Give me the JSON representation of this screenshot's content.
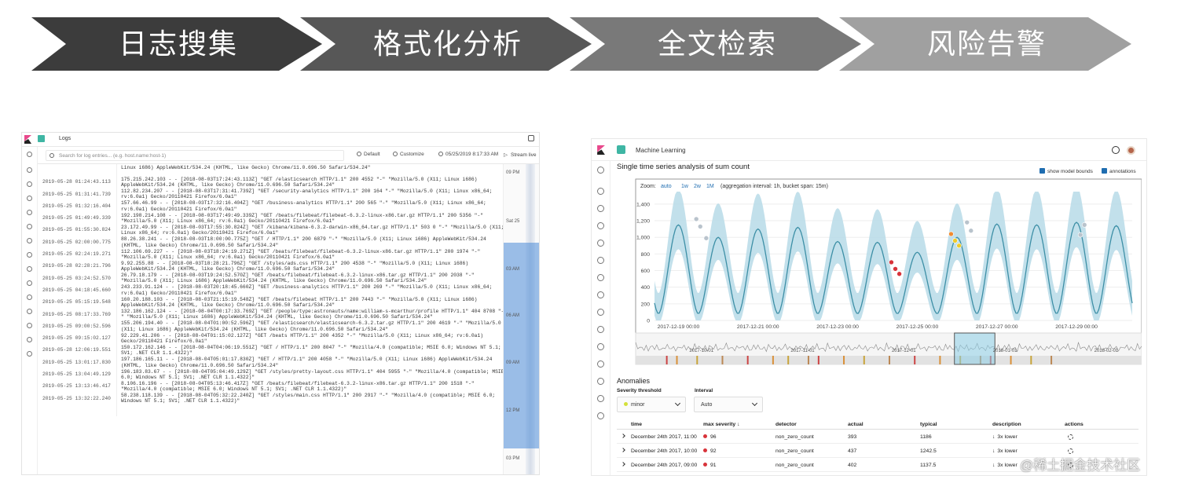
{
  "banner": {
    "steps": [
      "日志搜集",
      "格式化分析",
      "全文检索",
      "风险告警"
    ],
    "colors": [
      "#3c3c3c",
      "#575757",
      "#797979",
      "#a0a0a0"
    ]
  },
  "logs_app": {
    "title": "Logs",
    "search_placeholder": "Search for log entries... (e.g. host.name:host-1)",
    "default_label": "Default",
    "customize_label": "Customize",
    "date_label": "05/25/2019 8:17:33 AM",
    "stream_label": "Stream live",
    "minimap_labels": [
      "09 PM",
      "Sat 25",
      "03 AM",
      "06 AM",
      "09 AM",
      "12 PM",
      "03 PM"
    ],
    "rows": [
      {
        "ts": "",
        "msg": "Linux i686) AppleWebKit/534.24 (KHTML, like Gecko) Chrome/11.0.696.50 Safari/534.24\""
      },
      {
        "ts": "2019-05-28 01:24:43.113",
        "msg": "175.215.242.103 - - [2018-08-03T17:24:43.113Z] \"GET /elasticsearch HTTP/1.1\" 200 4552 \"-\" \"Mozilla/5.0 (X11; Linux i686) AppleWebKit/534.24 (KHTML, like Gecko) Chrome/11.0.696.50 Safari/534.24\""
      },
      {
        "ts": "2019-05-25 01:31:41.739",
        "msg": "112.82.234.207 - - [2018-08-03T17:31:41.739Z] \"GET /security-analytics HTTP/1.1\" 200 164 \"-\" \"Mozilla/5.0 (X11; Linux x86_64; rv:6.0a1) Gecko/20110421 Firefox/6.0a1\""
      },
      {
        "ts": "2019-05-25 01:32:16.404",
        "msg": "157.66.46.99 - - [2018-08-03T17:32:16.404Z] \"GET /business-analytics HTTP/1.1\" 200 565 \"-\" \"Mozilla/5.0 (X11; Linux x86_64; rv:6.0a1) Gecko/20110421 Firefox/6.0a1\""
      },
      {
        "ts": "2019-05-25 01:49:49.339",
        "msg": "192.198.214.108 - - [2018-08-03T17:49:49.339Z] \"GET /beats/filebeat/filebeat-6.3.2-linux-x86.tar.gz HTTP/1.1\" 200 5356 \"-\" \"Mozilla/5.0 (X11; Linux x86_64; rv:6.0a1) Gecko/20110421 Firefox/6.0a1\""
      },
      {
        "ts": "2019-05-25 01:55:30.824",
        "msg": "23.172.49.99 - - [2018-08-03T17:55:30.824Z] \"GET /kibana/kibana-6.3.2-darwin-x86_64.tar.gz HTTP/1.1\" 503 0 \"-\" \"Mozilla/5.0 (X11; Linux x86_64; rv:6.0a1) Gecko/20110421 Firefox/6.0a1\""
      },
      {
        "ts": "2019-05-25 02:00:00.775",
        "msg": "88.26.38.241 - - [2018-08-03T18:00:00.775Z] \"GET / HTTP/1.1\" 200 6879 \"-\" \"Mozilla/5.0 (X11; Linux i686) AppleWebKit/534.24 (KHTML, like Gecko) Chrome/11.0.696.50 Safari/534.24\""
      },
      {
        "ts": "2019-05-25 02:24:19.271",
        "msg": "112.106.69.227 - - [2018-08-03T18:24:19.271Z] \"GET /beats/filebeat/filebeat-6.3.2-linux-x86.tar.gz HTTP/1.1\" 200 1974 \"-\" \"Mozilla/5.0 (X11; Linux x86_64; rv:6.0a1) Gecko/20110421 Firefox/6.0a1\""
      },
      {
        "ts": "2019-05-28 02:28:21.796",
        "msg": "9.92.255.88 - - [2018-08-03T18:28:21.796Z] \"GET /styles/ads.css HTTP/1.1\" 200 4538 \"-\" \"Mozilla/5.0 (X11; Linux i686) AppleWebKit/534.24 (KHTML, like Gecko) Chrome/11.0.696.50 Safari/534.24\""
      },
      {
        "ts": "2019-05-25 03:24:52.570",
        "msg": "26.79.18.179 - - [2018-08-03T19:24:52.570Z] \"GET /beats/filebeat/filebeat-6.3.2-linux-x86.tar.gz HTTP/1.1\" 200 2038 \"-\" \"Mozilla/5.0 (X11; Linux i686) AppleWebKit/534.24 (KHTML, like Gecko) Chrome/11.0.696.50 Safari/534.24\""
      },
      {
        "ts": "2019-05-25 04:18:45.660",
        "msg": "243.233.91.124 - - [2018-08-03T20:18:45.660Z] \"GET /business-analytics HTTP/1.1\" 200 269 \"-\" \"Mozilla/5.0 (X11; Linux x86_64; rv:6.0a1) Gecko/20110421 Firefox/6.0a1\""
      },
      {
        "ts": "2019-05-25 05:15:19.548",
        "msg": "160.20.188.103 - - [2018-08-03T21:15:19.548Z] \"GET /beats/filebeat HTTP/1.1\" 200 7443 \"-\" \"Mozilla/5.0 (X11; Linux i686) AppleWebKit/534.24 (KHTML, like Gecko) Chrome/11.0.696.50 Safari/534.24\""
      },
      {
        "ts": "2019-05-25 08:17:33.769",
        "msg": "132.186.162.124 - - [2018-08-04T00:17:33.769Z] \"GET /people/type:astronauts/name:william-s-mcarthur/profile HTTP/1.1\" 404 8708 \"-\" \"Mozilla/5.0 (X11; Linux i686) AppleWebKit/534.24 (KHTML, like Gecko) Chrome/11.0.696.50 Safari/534.24\""
      },
      {
        "ts": "2019-05-25 09:00:52.596",
        "msg": "155.206.194.40 - - [2018-08-04T01:00:52.596Z] \"GET /elasticsearch/elasticsearch-6.3.2.tar.gz HTTP/1.1\" 200 4619 \"-\" \"Mozilla/5.0 (X11; Linux i686) AppleWebKit/534.24 (KHTML, like Gecko) Chrome/11.0.696.50 Safari/534.24\""
      },
      {
        "ts": "2019-05-25 09:15:02.127",
        "msg": "92.229.41.206 - - [2018-08-04T01:15:02.127Z] \"GET /beats HTTP/1.1\" 200 4352 \"-\" \"Mozilla/5.0 (X11; Linux x86_64; rv:6.0a1) Gecko/20110421 Firefox/6.0a1\""
      },
      {
        "ts": "2019-05-28 12:06:19.551",
        "msg": "150.172.162.146 - - [2018-08-04T04:06:19.551Z] \"GET / HTTP/1.1\" 200 8047 \"-\" \"Mozilla/4.0 (compatible; MSIE 6.0; Windows NT 5.1; SV1; .NET CLR 1.1.4322)\""
      },
      {
        "ts": "2019-05-25 13:01:17.830",
        "msg": "197.186.165.11 - - [2018-08-04T05:01:17.830Z] \"GET / HTTP/1.1\" 200 4058 \"-\" \"Mozilla/5.0 (X11; Linux i686) AppleWebKit/534.24 (KHTML, like Gecko) Chrome/11.0.696.50 Safari/534.24\""
      },
      {
        "ts": "2019-05-25 13:04:49.129",
        "msg": "196.183.83.67 - - [2018-08-04T05:04:49.129Z] \"GET /styles/pretty-layout.css HTTP/1.1\" 404 5955 \"-\" \"Mozilla/4.0 (compatible; MSIE 6.0; Windows NT 5.1; SV1; .NET CLR 1.1.4322)\""
      },
      {
        "ts": "2019-05-25 13:13:46.417",
        "msg": "8.106.16.196 - - [2018-08-04T05:13:46.417Z] \"GET /beats/filebeat/filebeat-6.3.2-linux-x86.tar.gz HTTP/1.1\" 200 1518 \"-\" \"Mozilla/4.0 (compatible; MSIE 6.0; Windows NT 5.1; SV1; .NET CLR 1.1.4322)\""
      },
      {
        "ts": "2019-05-25 13:32:22.240",
        "msg": "58.238.118.139 - - [2018-08-04T05:32:22.240Z] \"GET /styles/main.css HTTP/1.1\" 200 2917 \"-\" \"Mozilla/4.0 (compatible; MSIE 6.0; Windows NT 5.1; SV1; .NET CLR 1.1.4322)\""
      },
      {
        "ts": "",
        "msg": ""
      }
    ]
  },
  "ml_app": {
    "title": "Machine Learning",
    "page_title": "Single time series analysis of sum count",
    "show_model_bounds": "show model bounds",
    "annotations": "annotations",
    "chart_data": {
      "type": "line",
      "zoom_label": "Zoom:",
      "zoom_options": [
        "auto",
        "1w",
        "2w",
        "1M"
      ],
      "zoom_info": "(aggregation interval: 1h, bucket span: 15m)",
      "y_ticks": [
        "1,400",
        "1,200",
        "1,000",
        "800",
        "600",
        "400",
        "200",
        "0"
      ],
      "ylim": [
        0,
        1550
      ],
      "x_ticks": [
        "2017-12-19 00:00",
        "2017-12-21 00:00",
        "2017-12-23 00:00",
        "2017-12-25 00:00",
        "2017-12-27 00:00",
        "2017-12-29 00:00"
      ],
      "xlim_days": [
        -0.6,
        11.4
      ],
      "series": [
        {
          "name": "actual",
          "description": "daily cycle, ~12 peaks between 900 and 1200, troughs near 100"
        }
      ],
      "peaks": [
        1150,
        1000,
        1100,
        1120,
        950,
        940,
        820,
        1000,
        1160,
        1150,
        1180,
        1140
      ],
      "anomaly_markers": [
        {
          "day": 0.45,
          "value": 1220,
          "severity": "low"
        },
        {
          "day": 0.55,
          "value": 1130,
          "severity": "low"
        },
        {
          "day": 0.7,
          "value": 990,
          "severity": "low"
        },
        {
          "day": 5.35,
          "value": 700,
          "severity": "critical"
        },
        {
          "day": 5.45,
          "value": 620,
          "severity": "critical"
        },
        {
          "day": 5.55,
          "value": 560,
          "severity": "critical"
        },
        {
          "day": 6.85,
          "value": 1040,
          "severity": "major"
        },
        {
          "day": 6.95,
          "value": 960,
          "severity": "minor"
        },
        {
          "day": 7.05,
          "value": 900,
          "severity": "minor"
        },
        {
          "day": 7.25,
          "value": 1180,
          "severity": "low"
        },
        {
          "day": 7.35,
          "value": 1080,
          "severity": "low"
        },
        {
          "day": 10.1,
          "value": 1030,
          "severity": "low"
        },
        {
          "day": 10.2,
          "value": 1150,
          "severity": "low"
        }
      ],
      "context_labels": [
        "2017-10-01",
        "2017-11-01",
        "2017-12-01",
        "2018-01-01",
        "2018-02-01"
      ]
    },
    "anomalies_title": "Anomalies",
    "severity_label": "Severity threshold",
    "severity_value": "minor",
    "interval_label": "Interval",
    "interval_value": "Auto",
    "table": {
      "headers": [
        "time",
        "max severity ↓",
        "detector",
        "actual",
        "typical",
        "description",
        "actions"
      ],
      "rows": [
        {
          "time": "December 24th 2017, 11:00",
          "severity": "96",
          "detector": "non_zero_count",
          "actual": "393",
          "typical": "1186",
          "description": "3x lower"
        },
        {
          "time": "December 24th 2017, 10:00",
          "severity": "92",
          "detector": "non_zero_count",
          "actual": "437",
          "typical": "1242.5",
          "description": "3x lower"
        },
        {
          "time": "December 24th 2017, 09:00",
          "severity": "91",
          "detector": "non_zero_count",
          "actual": "402",
          "typical": "1137.5",
          "description": "3x lower"
        }
      ]
    }
  },
  "watermark": "@稀土掘金技术社区"
}
